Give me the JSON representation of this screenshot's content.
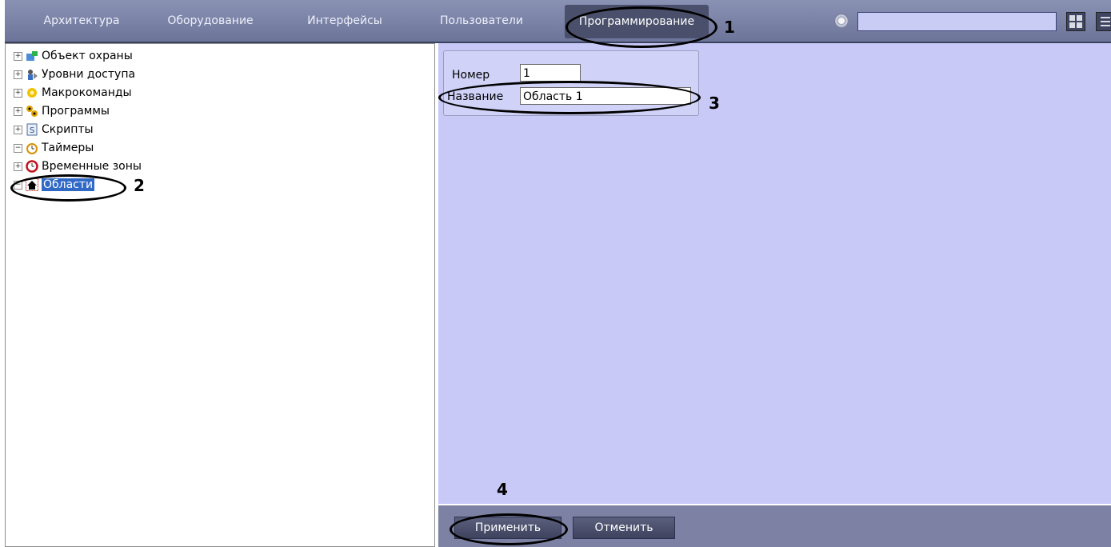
{
  "top_menu": {
    "tabs": [
      "Архитектура",
      "Оборудование",
      "Интерфейсы",
      "Пользователи",
      "Программирование"
    ],
    "active_tab": "Программирование",
    "search_value": ""
  },
  "tree": {
    "items": [
      {
        "label": "Объект охраны",
        "expander": "+",
        "icon": "security-object-icon"
      },
      {
        "label": "Уровни доступа",
        "expander": "+",
        "icon": "access-levels-icon"
      },
      {
        "label": "Макрокоманды",
        "expander": "+",
        "icon": "macro-icon"
      },
      {
        "label": "Программы",
        "expander": "+",
        "icon": "programs-icon"
      },
      {
        "label": "Скрипты",
        "expander": "+",
        "icon": "scripts-icon"
      },
      {
        "label": "Таймеры",
        "expander": "−",
        "icon": "timer-icon"
      },
      {
        "label": "Временные зоны",
        "expander": "+",
        "icon": "time-zone-icon"
      },
      {
        "label": "Области",
        "expander": "−",
        "icon": "area-icon",
        "selected": true
      }
    ]
  },
  "form": {
    "number_label": "Номер",
    "number_value": "1",
    "name_label": "Название",
    "name_value": "Область 1"
  },
  "buttons": {
    "apply": "Применить",
    "cancel": "Отменить"
  },
  "callouts": [
    "1",
    "2",
    "3",
    "4"
  ]
}
